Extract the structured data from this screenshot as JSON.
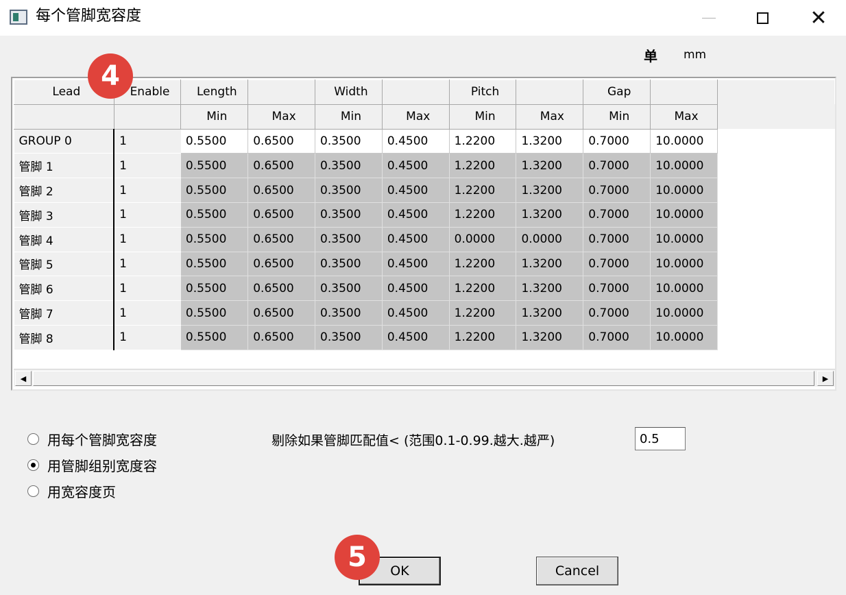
{
  "window": {
    "title": "每个管脚宽容度",
    "controls": {
      "minimize": "—",
      "maximize": "☐",
      "close": "✕"
    }
  },
  "units": {
    "label": "单",
    "value": "mm"
  },
  "table": {
    "headers_top": [
      "Lead",
      "Enable",
      "Length",
      "",
      "Width",
      "",
      "Pitch",
      "",
      "Gap",
      ""
    ],
    "headers_sub": [
      "",
      "",
      "Min",
      "Max",
      "Min",
      "Max",
      "Min",
      "Max",
      "Min",
      "Max"
    ],
    "rows": [
      {
        "lead": "GROUP 0",
        "enable": "1",
        "values": [
          "0.5500",
          "0.6500",
          "0.3500",
          "0.4500",
          "1.2200",
          "1.3200",
          "0.7000",
          "10.0000"
        ]
      },
      {
        "lead": "管脚 1",
        "enable": "1",
        "values": [
          "0.5500",
          "0.6500",
          "0.3500",
          "0.4500",
          "1.2200",
          "1.3200",
          "0.7000",
          "10.0000"
        ]
      },
      {
        "lead": "管脚 2",
        "enable": "1",
        "values": [
          "0.5500",
          "0.6500",
          "0.3500",
          "0.4500",
          "1.2200",
          "1.3200",
          "0.7000",
          "10.0000"
        ]
      },
      {
        "lead": "管脚 3",
        "enable": "1",
        "values": [
          "0.5500",
          "0.6500",
          "0.3500",
          "0.4500",
          "1.2200",
          "1.3200",
          "0.7000",
          "10.0000"
        ]
      },
      {
        "lead": "管脚 4",
        "enable": "1",
        "values": [
          "0.5500",
          "0.6500",
          "0.3500",
          "0.4500",
          "0.0000",
          "0.0000",
          "0.7000",
          "10.0000"
        ]
      },
      {
        "lead": "管脚 5",
        "enable": "1",
        "values": [
          "0.5500",
          "0.6500",
          "0.3500",
          "0.4500",
          "1.2200",
          "1.3200",
          "0.7000",
          "10.0000"
        ]
      },
      {
        "lead": "管脚 6",
        "enable": "1",
        "values": [
          "0.5500",
          "0.6500",
          "0.3500",
          "0.4500",
          "1.2200",
          "1.3200",
          "0.7000",
          "10.0000"
        ]
      },
      {
        "lead": "管脚 7",
        "enable": "1",
        "values": [
          "0.5500",
          "0.6500",
          "0.3500",
          "0.4500",
          "1.2200",
          "1.3200",
          "0.7000",
          "10.0000"
        ]
      },
      {
        "lead": "管脚 8",
        "enable": "1",
        "values": [
          "0.5500",
          "0.6500",
          "0.3500",
          "0.4500",
          "1.2200",
          "1.3200",
          "0.7000",
          "10.0000"
        ]
      }
    ]
  },
  "scrollbar": {
    "left_arrow": "◀",
    "right_arrow": "▶"
  },
  "options": [
    {
      "label": "用每个管脚宽容度",
      "selected": false
    },
    {
      "label": "用管脚组别宽度容",
      "selected": true
    },
    {
      "label": "用宽容度页",
      "selected": false
    }
  ],
  "reject": {
    "label": "剔除如果管脚匹配值< (范围0.1-0.99.越大.越严)",
    "value": "0.5"
  },
  "buttons": {
    "ok": "OK",
    "cancel": "Cancel"
  },
  "callouts": {
    "first": "4",
    "second": "5"
  },
  "colors": {
    "callout": "#e0433b",
    "locked_cell": "#c4c4c4"
  }
}
